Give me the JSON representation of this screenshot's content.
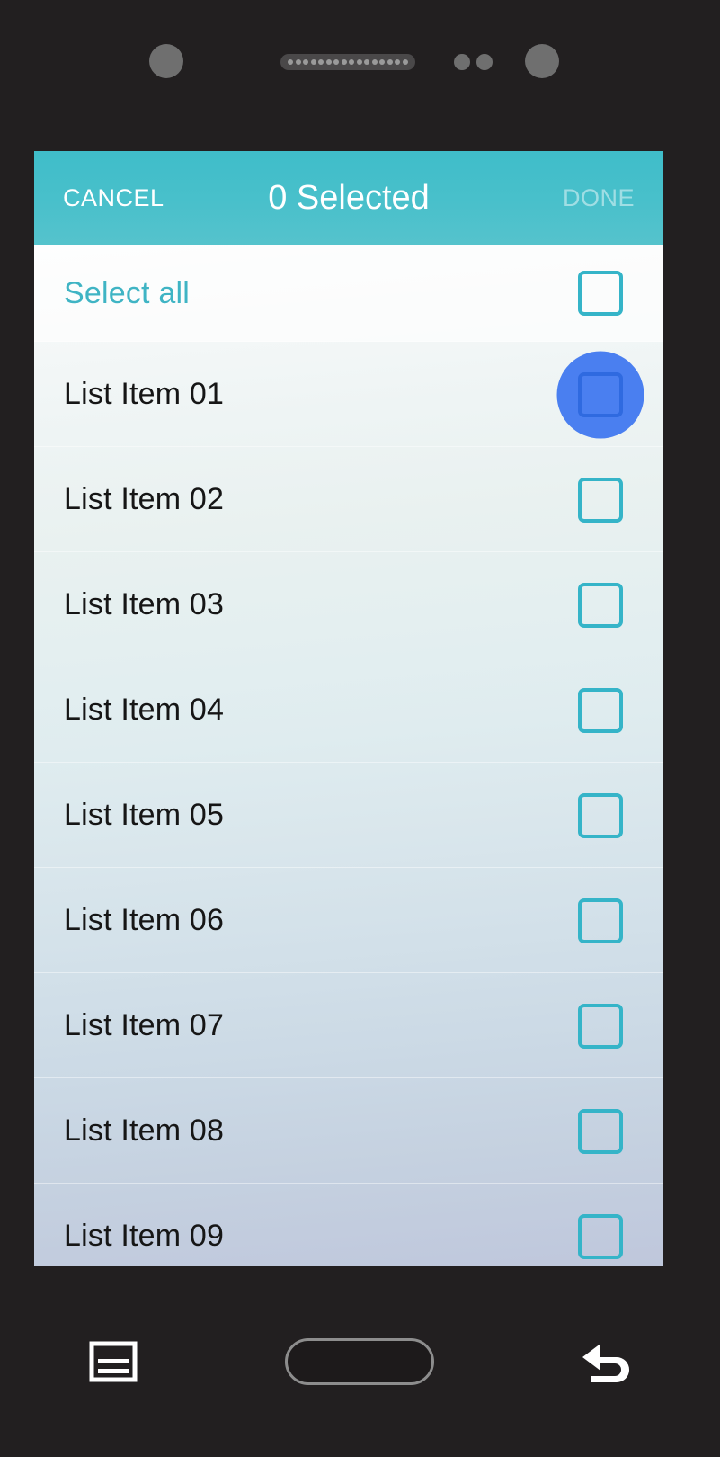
{
  "device": {
    "hardware": {
      "camera_left": "camera-lens",
      "speaker": "earpiece-speaker-grille",
      "speaker_dot_count": 16,
      "sensor_a": "proximity-sensor",
      "sensor_b": "ambient-light-sensor",
      "camera_right": "front-camera"
    }
  },
  "appbar": {
    "cancel_label": "CANCEL",
    "title": "0 Selected",
    "done_label": "DONE",
    "done_enabled": false,
    "background_color": "#49c0cb",
    "text_color": "#ffffff",
    "done_text_color": "#a8dfe5"
  },
  "list": {
    "select_all": {
      "label": "Select all",
      "checked": false,
      "text_color": "#3fb4c4"
    },
    "checkbox_color": "#35b4c8",
    "ripple_color": "#4a7ff0",
    "items": [
      {
        "label": "List Item 01",
        "checked": false,
        "pressed": true
      },
      {
        "label": "List Item 02",
        "checked": false,
        "pressed": false
      },
      {
        "label": "List Item 03",
        "checked": false,
        "pressed": false
      },
      {
        "label": "List Item 04",
        "checked": false,
        "pressed": false
      },
      {
        "label": "List Item 05",
        "checked": false,
        "pressed": false
      },
      {
        "label": "List Item 06",
        "checked": false,
        "pressed": false
      },
      {
        "label": "List Item 07",
        "checked": false,
        "pressed": false
      },
      {
        "label": "List Item 08",
        "checked": false,
        "pressed": false
      },
      {
        "label": "List Item 09",
        "checked": false,
        "pressed": false
      }
    ]
  },
  "navbar": {
    "recents_label": "recent-apps",
    "home_label": "home",
    "back_label": "back",
    "icon_color": "#ffffff"
  }
}
